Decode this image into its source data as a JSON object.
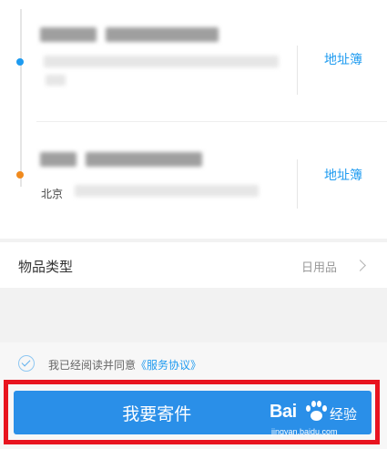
{
  "sender": {
    "address_book_label": "地址簿"
  },
  "receiver": {
    "address_book_label": "地址簿",
    "address_prefix": "北京"
  },
  "item_type": {
    "label": "物品类型",
    "value": "日用品"
  },
  "agreement": {
    "text": "我已经阅读并同意",
    "link": "《服务协议》",
    "checked": true
  },
  "submit": {
    "label": "我要寄件"
  },
  "watermark": {
    "brand": "Bai",
    "brand_cn": "经验",
    "url": "jingyan.baidu.com"
  },
  "colors": {
    "accent": "#1e9bf0",
    "sender_dot": "#1e9bf0",
    "receiver_dot": "#f08a1e",
    "highlight_frame": "#e8141f",
    "button": "#2a8fe8"
  }
}
